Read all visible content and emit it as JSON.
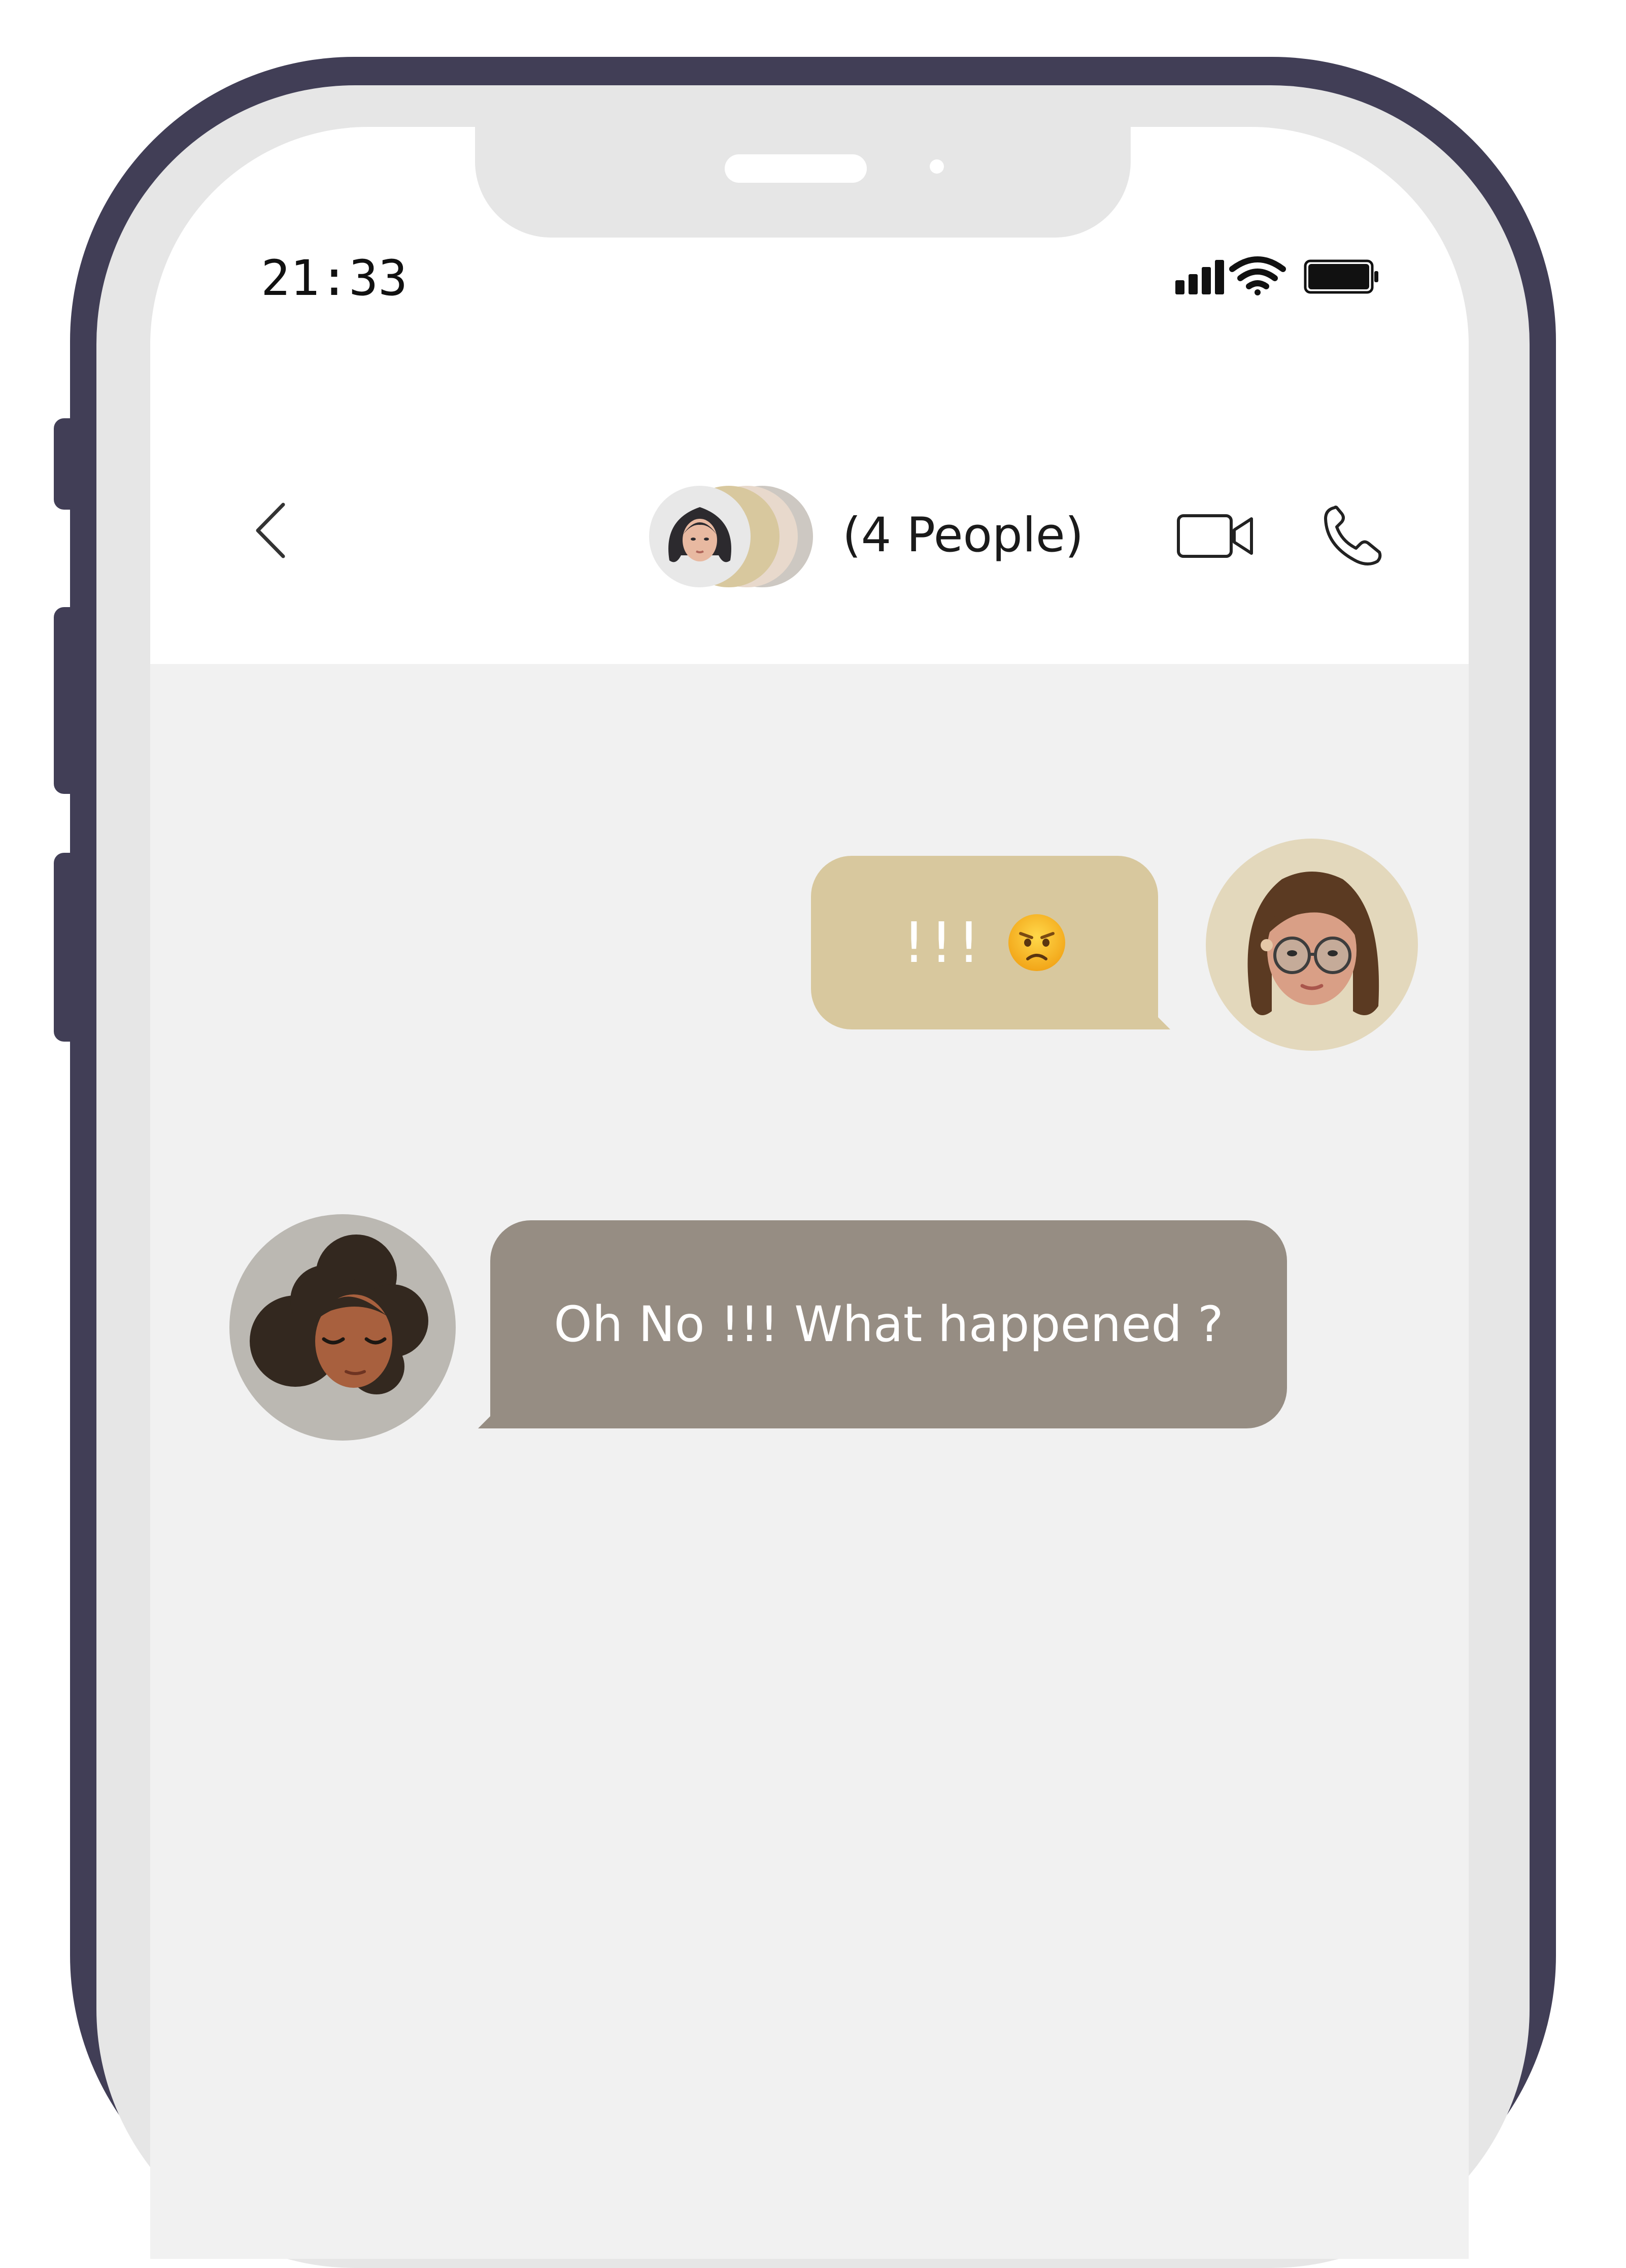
{
  "status_bar": {
    "time": "21:33",
    "icons": [
      "signal-icon",
      "wifi-icon",
      "battery-icon"
    ]
  },
  "header": {
    "back_icon": "chevron-left-icon",
    "group_title": "(4 People)",
    "video_icon": "video-camera-icon",
    "call_icon": "phone-icon"
  },
  "messages": [
    {
      "direction": "outgoing",
      "text": "!!!",
      "emoji": "angry-face-emoji",
      "bubble_color": "#d8c89e"
    },
    {
      "direction": "incoming",
      "text": "Oh No !!! What happened ?",
      "bubble_color": "#968d83"
    }
  ],
  "colors": {
    "phone_frame": "#413e56",
    "bezel": "#e6e6e6",
    "chat_background": "#f1f1f1",
    "header_background": "#ffffff"
  }
}
